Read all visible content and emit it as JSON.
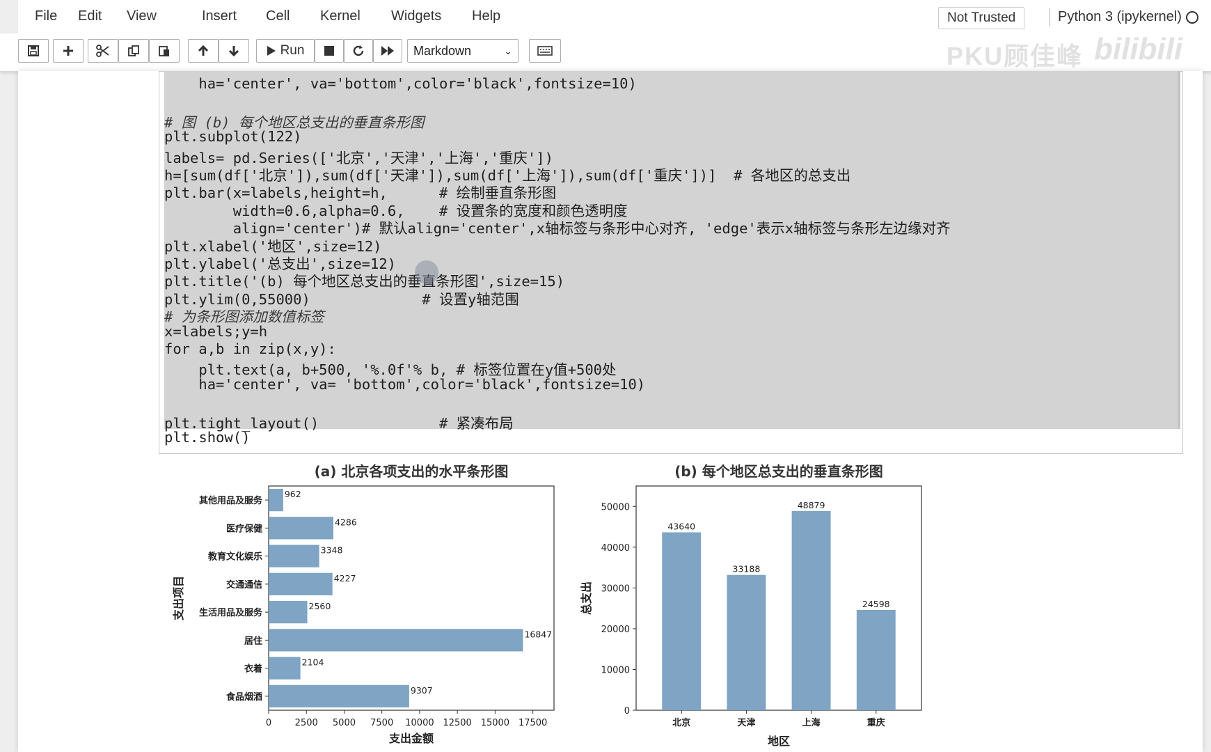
{
  "menu": {
    "items": [
      "File",
      "Edit",
      "View",
      "Insert",
      "Cell",
      "Kernel",
      "Widgets",
      "Help"
    ]
  },
  "trust_label": "Not Trusted",
  "kernel": {
    "name": "Python 3 (ipykernel)"
  },
  "toolbar": {
    "run_label": "Run",
    "cell_type": "Markdown"
  },
  "watermark": {
    "text": "PKU顾佳峰",
    "logo": "bilibili"
  },
  "code_lines": [
    "    ha='center', va='bottom',color='black',fontsize=10)",
    "",
    "# 图 (b) 每个地区总支出的垂直条形图",
    "plt.subplot(122)",
    "labels= pd.Series(['北京','天津','上海','重庆'])",
    "h=[sum(df['北京']),sum(df['天津']),sum(df['上海']),sum(df['重庆'])]  # 各地区的总支出",
    "plt.bar(x=labels,height=h,      # 绘制垂直条形图",
    "        width=0.6,alpha=0.6,    # 设置条的宽度和颜色透明度",
    "        align='center')# 默认align='center',x轴标签与条形中心对齐, 'edge'表示x轴标签与条形左边缘对齐",
    "plt.xlabel('地区',size=12)",
    "plt.ylabel('总支出',size=12)",
    "plt.title('(b) 每个地区总支出的垂直条形图',size=15)",
    "plt.ylim(0,55000)             # 设置y轴范围",
    "# 为条形图添加数值标签",
    "x=labels;y=h",
    "for a,b in zip(x,y):",
    "    plt.text(a, b+500, '%.0f'% b, # 标签位置在y值+500处",
    "    ha='center', va= 'bottom',color='black',fontsize=10)",
    "",
    "plt.tight_layout()              # 紧凑布局",
    "plt.show()"
  ],
  "chart_data": [
    {
      "type": "bar",
      "orientation": "horizontal",
      "title": "(a) 北京各项支出的水平条形图",
      "xlabel": "支出金额",
      "ylabel": "支出项目",
      "categories": [
        "食品烟酒",
        "衣着",
        "居住",
        "生活用品及服务",
        "交通通信",
        "教育文化娱乐",
        "医疗保健",
        "其他用品及服务"
      ],
      "values": [
        9307,
        2104,
        16847,
        2560,
        4227,
        3348,
        4286,
        962
      ],
      "xlim": [
        0,
        18900
      ],
      "xticks": [
        "0",
        "2500",
        "5000",
        "7500",
        "10000",
        "12500",
        "15000",
        "17500"
      ],
      "bar_color": "#7fa4c4"
    },
    {
      "type": "bar",
      "orientation": "vertical",
      "title": "(b) 每个地区总支出的垂直条形图",
      "xlabel": "地区",
      "ylabel": "总支出",
      "categories": [
        "北京",
        "天津",
        "上海",
        "重庆"
      ],
      "values": [
        43640,
        33188,
        48879,
        24598
      ],
      "ylim": [
        0,
        55000
      ],
      "yticks": [
        "0",
        "10000",
        "20000",
        "30000",
        "40000",
        "50000"
      ],
      "bar_color": "#7fa4c4"
    }
  ]
}
